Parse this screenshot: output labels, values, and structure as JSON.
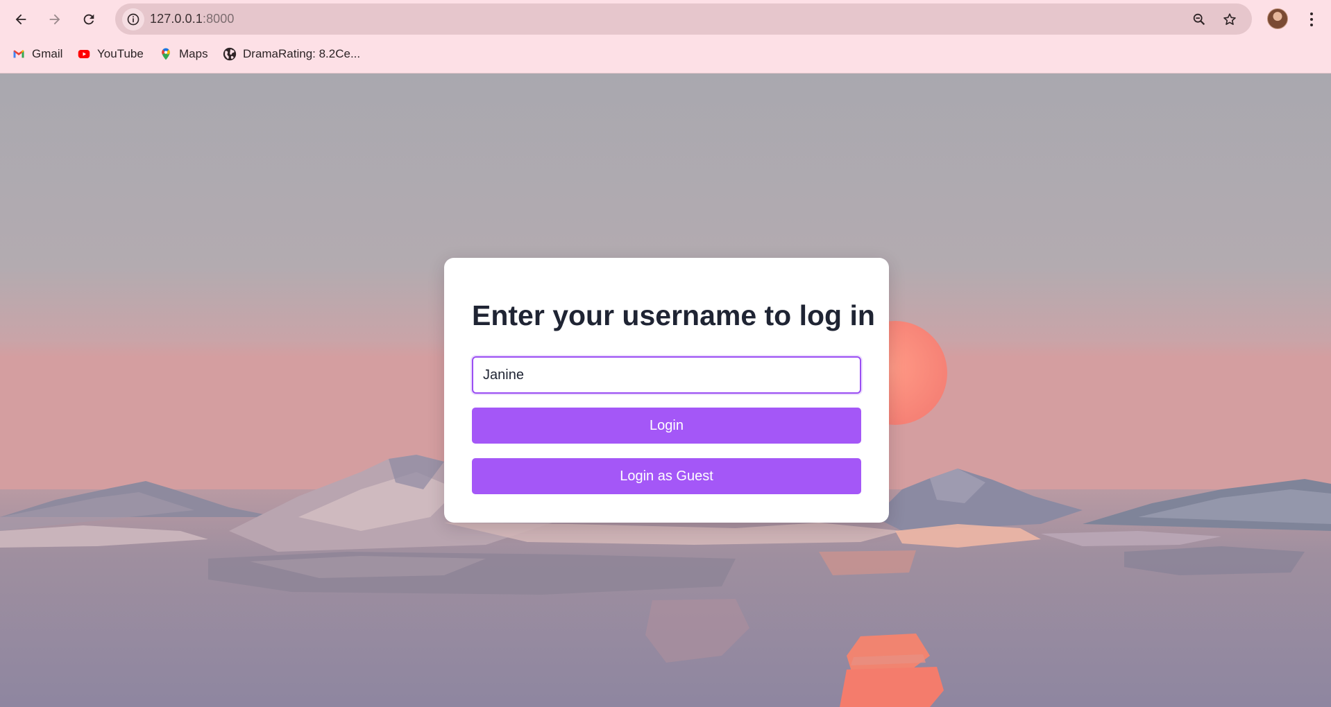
{
  "browser": {
    "url_host": "127.0.0.1",
    "url_port": ":8000",
    "bookmarks": [
      {
        "label": "Gmail",
        "icon": "gmail-icon"
      },
      {
        "label": "YouTube",
        "icon": "youtube-icon"
      },
      {
        "label": "Maps",
        "icon": "maps-icon"
      },
      {
        "label": "DramaRating: 8.2Ce...",
        "icon": "globe-icon"
      }
    ]
  },
  "login": {
    "title": "Enter your username to log in",
    "username_value": "Janine",
    "login_label": "Login",
    "guest_label": "Login as Guest"
  },
  "colors": {
    "chrome_bg": "#fde0e6",
    "accent": "#a457f7",
    "input_border": "#9a4ef3",
    "title_text": "#1f2433"
  }
}
